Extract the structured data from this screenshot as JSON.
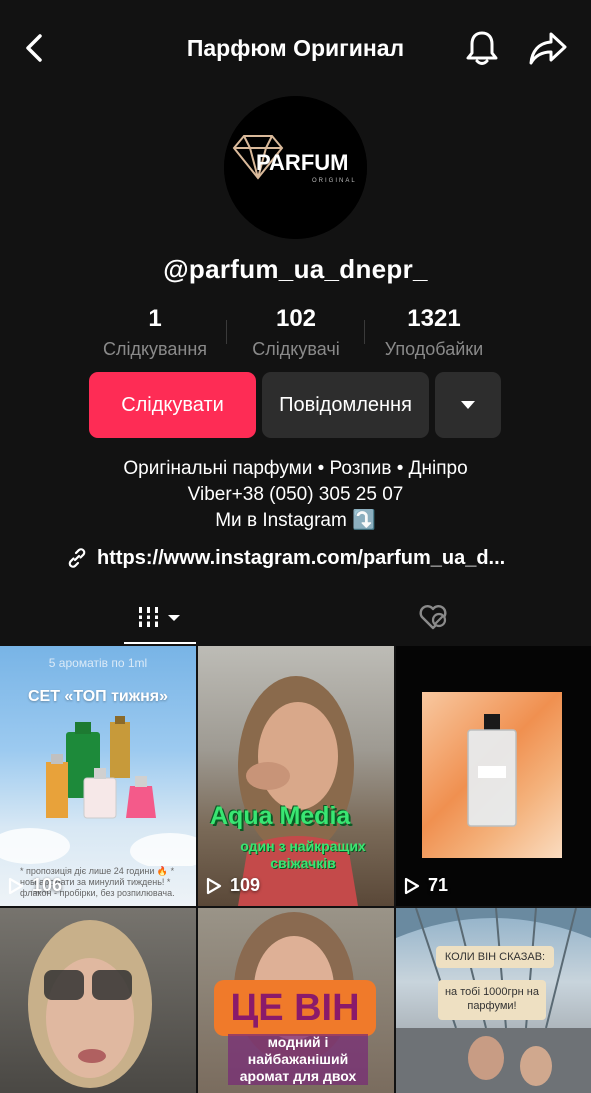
{
  "header": {
    "title": "Парфюм Оригинал"
  },
  "profile": {
    "avatar_logo": "PARFUM",
    "avatar_logo_sub": "ORIGINAL",
    "username": "@parfum_ua_dnepr_"
  },
  "stats": [
    {
      "value": "1",
      "label": "Слідкування"
    },
    {
      "value": "102",
      "label": "Слідкувачі"
    },
    {
      "value": "1321",
      "label": "Уподобайки"
    }
  ],
  "actions": {
    "follow": "Слідкувати",
    "message": "Повідомлення"
  },
  "bio": {
    "line1": "Оригінальні парфуми • Розпив • Дніпро",
    "line2": "Viber+38 (050) 305 25 07",
    "line3": "Ми в Instagram ⤵️",
    "link": "https://www.instagram.com/parfum_ua_d..."
  },
  "videos": [
    {
      "views": "106",
      "subtitle": "5 ароматів по 1ml",
      "headline": "СЕТ «ТОП тижня»",
      "note": "* пропозиція діє лише 24 години 🔥 * нові аромати за минулий тиждень! * флакон - пробірки, без розпилювача."
    },
    {
      "views": "109",
      "headline": "Aqua Media",
      "caption": "один з найкращих свіжачків"
    },
    {
      "views": "71"
    },
    {
      "views": ""
    },
    {
      "views": "",
      "headline": "ЦЕ ВІН",
      "caption": "модний і найбажаніший аромат для двох"
    },
    {
      "views": "",
      "bubble1": "КОЛИ ВІН СКАЗАВ:",
      "bubble2": "на тобі 1000грн на парфуми!"
    }
  ],
  "colors": {
    "background": "#121212",
    "accent": "#fe2c55",
    "secondary_button": "#2d2d2d",
    "muted_text": "#8a8a8a"
  }
}
